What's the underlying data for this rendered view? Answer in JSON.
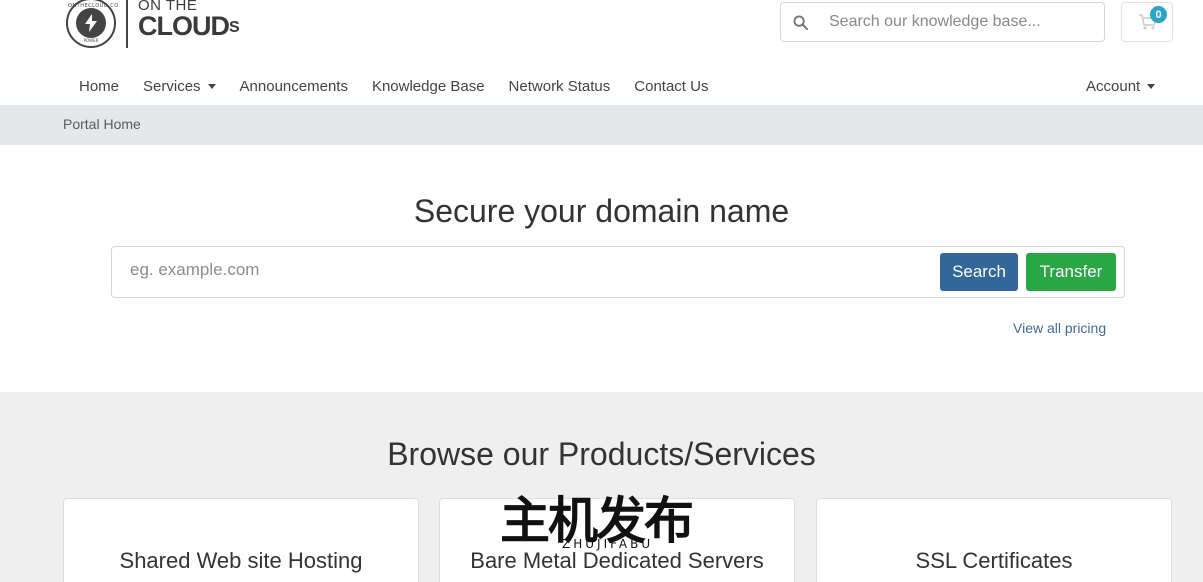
{
  "header": {
    "logo": {
      "top_text": "ON THE",
      "bottom_text": "CLOUD",
      "suffix": "S",
      "badge_ring_text": "ONTHECLOUD.CO",
      "badge_ring_bottom": "POWER"
    },
    "kb_search": {
      "placeholder": "Search our knowledge base..."
    },
    "cart": {
      "count": "0"
    }
  },
  "nav": {
    "items": [
      {
        "label": "Home",
        "dropdown": false
      },
      {
        "label": "Services",
        "dropdown": true
      },
      {
        "label": "Announcements",
        "dropdown": false
      },
      {
        "label": "Knowledge Base",
        "dropdown": false
      },
      {
        "label": "Network Status",
        "dropdown": false
      },
      {
        "label": "Contact Us",
        "dropdown": false
      }
    ],
    "account_label": "Account"
  },
  "breadcrumb": {
    "current": "Portal Home"
  },
  "domain": {
    "title": "Secure your domain name",
    "input_placeholder": "eg. example.com",
    "search_label": "Search",
    "transfer_label": "Transfer",
    "view_pricing_label": "View all pricing"
  },
  "products": {
    "title": "Browse our Products/Services",
    "cards": [
      {
        "title": "Shared Web site Hosting"
      },
      {
        "title": "Bare Metal Dedicated Servers"
      },
      {
        "title": "SSL Certificates"
      }
    ]
  },
  "watermark": {
    "cn": "主机发布",
    "en": "ZHUJIFABU"
  },
  "colors": {
    "search_button": "#336699",
    "transfer_button": "#29a745",
    "cart_badge": "#2aa5c8",
    "breadcrumb_bar": "#e5e8eb",
    "products_bg": "#efefef",
    "link": "#41699a"
  }
}
